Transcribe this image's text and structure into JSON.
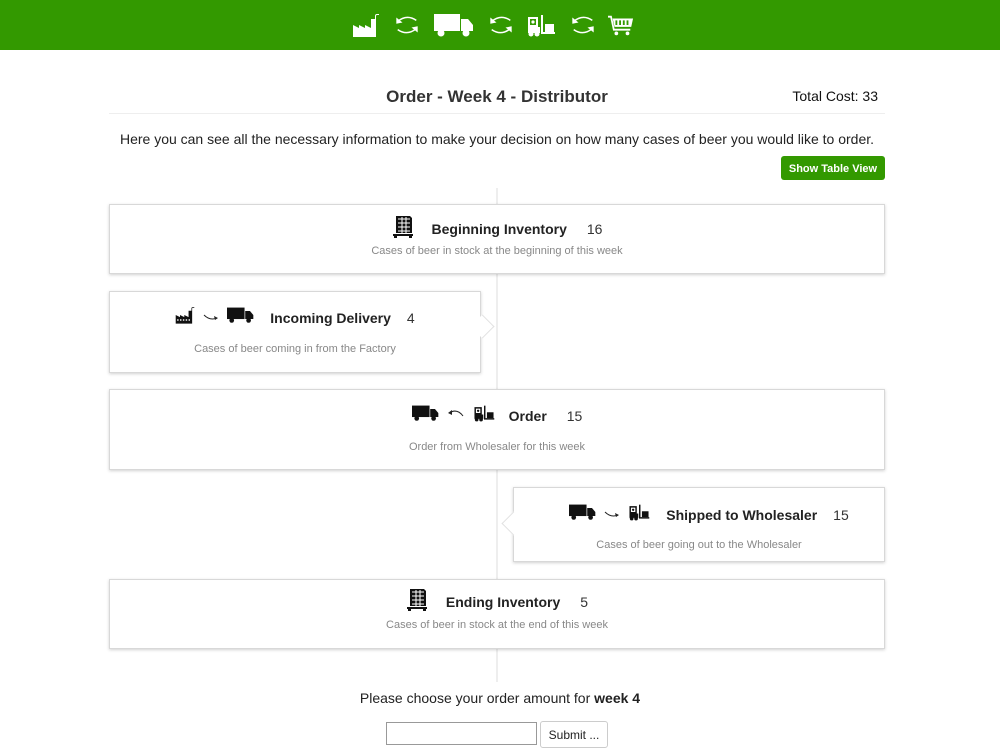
{
  "topbar": {
    "color": "#339900",
    "icons": [
      "factory-icon",
      "cycle-arrows-icon",
      "truck-icon",
      "cycle-arrows-icon",
      "forklift-icon",
      "cycle-arrows-icon",
      "shopping-cart-icon"
    ]
  },
  "header": {
    "title": "Order - Week 4 - Distributor",
    "total_cost_label": "Total Cost: 33"
  },
  "intro": "Here you can see all the necessary information to make your decision on how many cases of beer you would like to order.",
  "buttons": {
    "show_table_view": "Show Table View",
    "submit": "Submit ..."
  },
  "cards": {
    "beginning_inventory": {
      "label": "Beginning Inventory",
      "value": "16",
      "description": "Cases of beer in stock at the beginning of this week"
    },
    "incoming_delivery": {
      "label": "Incoming Delivery",
      "value": "4",
      "description": "Cases of beer coming in from the Factory"
    },
    "order": {
      "label": "Order",
      "value": "15",
      "description": "Order from Wholesaler for this week"
    },
    "shipped": {
      "label": "Shipped to Wholesaler",
      "value": "15",
      "description": "Cases of beer going out to the Wholesaler"
    },
    "ending_inventory": {
      "label": "Ending Inventory",
      "value": "5",
      "description": "Cases of beer in stock at the end of this week"
    }
  },
  "order_form": {
    "prompt": "Please choose your order amount for ",
    "week": "week 4",
    "input_value": "",
    "input_placeholder": ""
  }
}
